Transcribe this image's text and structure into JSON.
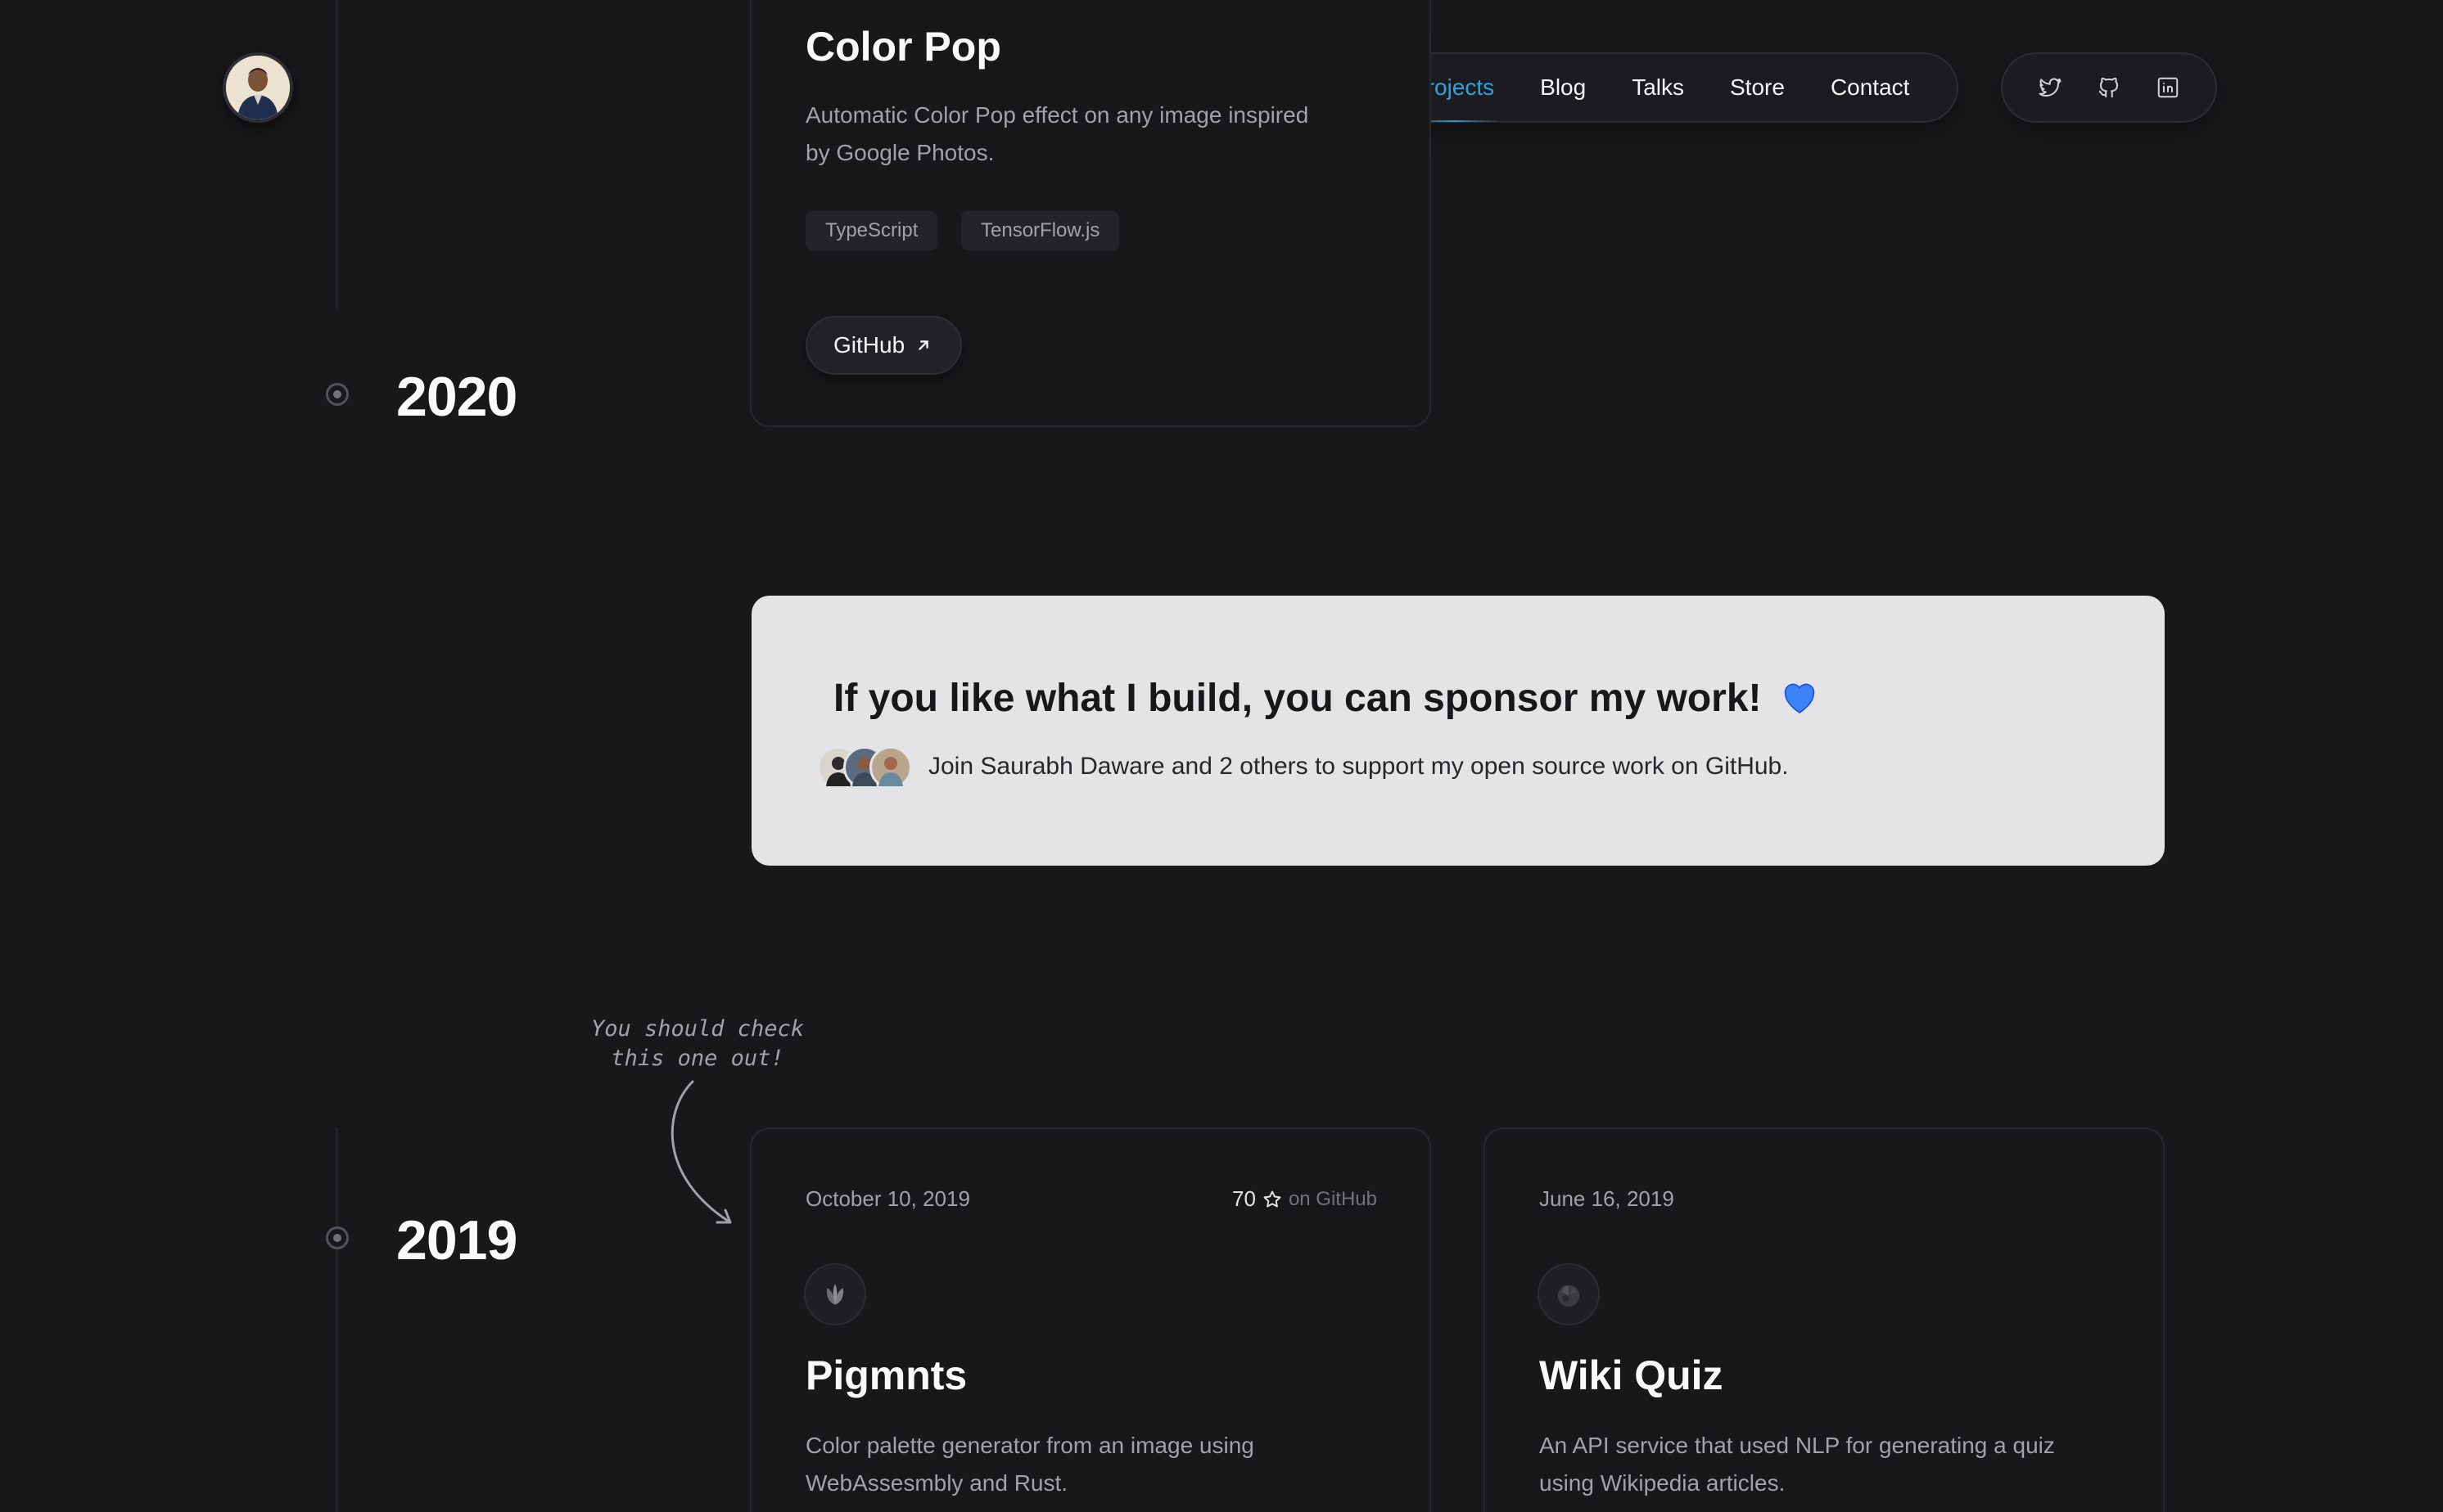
{
  "nav": {
    "items": [
      {
        "label": "Projects",
        "active": true
      },
      {
        "label": "Blog",
        "active": false
      },
      {
        "label": "Talks",
        "active": false
      },
      {
        "label": "Store",
        "active": false
      },
      {
        "label": "Contact",
        "active": false
      }
    ],
    "social": [
      "twitter-icon",
      "github-icon",
      "linkedin-icon"
    ]
  },
  "colors": {
    "accent": "#2aa3e0",
    "background": "#18181b",
    "sponsor_background": "#e4e4e7",
    "heart": "#3b82f6"
  },
  "timeline": {
    "years": [
      "2020",
      "2019"
    ]
  },
  "color_pop": {
    "title": "Color Pop",
    "description_line1": "Automatic Color Pop effect on any image inspired",
    "description_line2": "by Google Photos.",
    "tags": [
      "TypeScript",
      "TensorFlow.js"
    ],
    "link_label": "GitHub"
  },
  "sponsor": {
    "title": "If you like what I build, you can sponsor my work!",
    "heart": "💙",
    "text": "Join Saurabh Daware and 2 others to support my open source work on GitHub."
  },
  "annotation": {
    "line1": "You should check",
    "line2": "this one out!"
  },
  "pigmnts": {
    "date": "October 10, 2019",
    "stars": "70",
    "stars_suffix": "on GitHub",
    "title": "Pigmnts",
    "description_line1": "Color palette generator from an image using",
    "description_line2": "WebAssesmbly and Rust."
  },
  "wiki_quiz": {
    "date": "June 16, 2019",
    "title": "Wiki Quiz",
    "description_line1": "An API service that used NLP for generating a quiz",
    "description_line2": "using Wikipedia articles."
  }
}
